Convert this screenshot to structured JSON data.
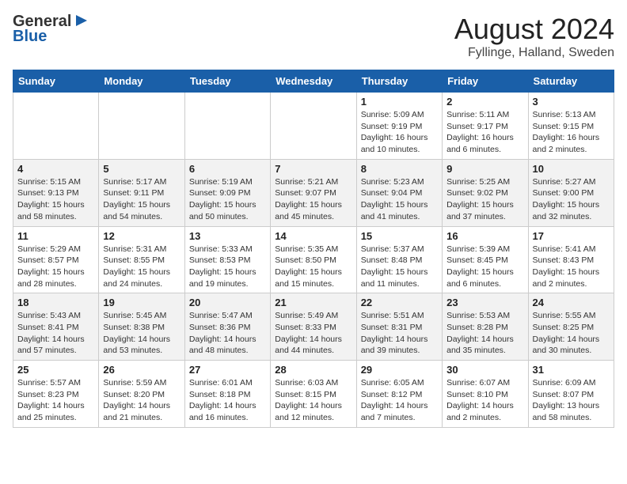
{
  "header": {
    "logo_line1": "General",
    "logo_line2": "Blue",
    "title": "August 2024",
    "subtitle": "Fyllinge, Halland, Sweden"
  },
  "weekdays": [
    "Sunday",
    "Monday",
    "Tuesday",
    "Wednesday",
    "Thursday",
    "Friday",
    "Saturday"
  ],
  "weeks": [
    [
      {
        "day": "",
        "info": ""
      },
      {
        "day": "",
        "info": ""
      },
      {
        "day": "",
        "info": ""
      },
      {
        "day": "",
        "info": ""
      },
      {
        "day": "1",
        "info": "Sunrise: 5:09 AM\nSunset: 9:19 PM\nDaylight: 16 hours\nand 10 minutes."
      },
      {
        "day": "2",
        "info": "Sunrise: 5:11 AM\nSunset: 9:17 PM\nDaylight: 16 hours\nand 6 minutes."
      },
      {
        "day": "3",
        "info": "Sunrise: 5:13 AM\nSunset: 9:15 PM\nDaylight: 16 hours\nand 2 minutes."
      }
    ],
    [
      {
        "day": "4",
        "info": "Sunrise: 5:15 AM\nSunset: 9:13 PM\nDaylight: 15 hours\nand 58 minutes."
      },
      {
        "day": "5",
        "info": "Sunrise: 5:17 AM\nSunset: 9:11 PM\nDaylight: 15 hours\nand 54 minutes."
      },
      {
        "day": "6",
        "info": "Sunrise: 5:19 AM\nSunset: 9:09 PM\nDaylight: 15 hours\nand 50 minutes."
      },
      {
        "day": "7",
        "info": "Sunrise: 5:21 AM\nSunset: 9:07 PM\nDaylight: 15 hours\nand 45 minutes."
      },
      {
        "day": "8",
        "info": "Sunrise: 5:23 AM\nSunset: 9:04 PM\nDaylight: 15 hours\nand 41 minutes."
      },
      {
        "day": "9",
        "info": "Sunrise: 5:25 AM\nSunset: 9:02 PM\nDaylight: 15 hours\nand 37 minutes."
      },
      {
        "day": "10",
        "info": "Sunrise: 5:27 AM\nSunset: 9:00 PM\nDaylight: 15 hours\nand 32 minutes."
      }
    ],
    [
      {
        "day": "11",
        "info": "Sunrise: 5:29 AM\nSunset: 8:57 PM\nDaylight: 15 hours\nand 28 minutes."
      },
      {
        "day": "12",
        "info": "Sunrise: 5:31 AM\nSunset: 8:55 PM\nDaylight: 15 hours\nand 24 minutes."
      },
      {
        "day": "13",
        "info": "Sunrise: 5:33 AM\nSunset: 8:53 PM\nDaylight: 15 hours\nand 19 minutes."
      },
      {
        "day": "14",
        "info": "Sunrise: 5:35 AM\nSunset: 8:50 PM\nDaylight: 15 hours\nand 15 minutes."
      },
      {
        "day": "15",
        "info": "Sunrise: 5:37 AM\nSunset: 8:48 PM\nDaylight: 15 hours\nand 11 minutes."
      },
      {
        "day": "16",
        "info": "Sunrise: 5:39 AM\nSunset: 8:45 PM\nDaylight: 15 hours\nand 6 minutes."
      },
      {
        "day": "17",
        "info": "Sunrise: 5:41 AM\nSunset: 8:43 PM\nDaylight: 15 hours\nand 2 minutes."
      }
    ],
    [
      {
        "day": "18",
        "info": "Sunrise: 5:43 AM\nSunset: 8:41 PM\nDaylight: 14 hours\nand 57 minutes."
      },
      {
        "day": "19",
        "info": "Sunrise: 5:45 AM\nSunset: 8:38 PM\nDaylight: 14 hours\nand 53 minutes."
      },
      {
        "day": "20",
        "info": "Sunrise: 5:47 AM\nSunset: 8:36 PM\nDaylight: 14 hours\nand 48 minutes."
      },
      {
        "day": "21",
        "info": "Sunrise: 5:49 AM\nSunset: 8:33 PM\nDaylight: 14 hours\nand 44 minutes."
      },
      {
        "day": "22",
        "info": "Sunrise: 5:51 AM\nSunset: 8:31 PM\nDaylight: 14 hours\nand 39 minutes."
      },
      {
        "day": "23",
        "info": "Sunrise: 5:53 AM\nSunset: 8:28 PM\nDaylight: 14 hours\nand 35 minutes."
      },
      {
        "day": "24",
        "info": "Sunrise: 5:55 AM\nSunset: 8:25 PM\nDaylight: 14 hours\nand 30 minutes."
      }
    ],
    [
      {
        "day": "25",
        "info": "Sunrise: 5:57 AM\nSunset: 8:23 PM\nDaylight: 14 hours\nand 25 minutes."
      },
      {
        "day": "26",
        "info": "Sunrise: 5:59 AM\nSunset: 8:20 PM\nDaylight: 14 hours\nand 21 minutes."
      },
      {
        "day": "27",
        "info": "Sunrise: 6:01 AM\nSunset: 8:18 PM\nDaylight: 14 hours\nand 16 minutes."
      },
      {
        "day": "28",
        "info": "Sunrise: 6:03 AM\nSunset: 8:15 PM\nDaylight: 14 hours\nand 12 minutes."
      },
      {
        "day": "29",
        "info": "Sunrise: 6:05 AM\nSunset: 8:12 PM\nDaylight: 14 hours\nand 7 minutes."
      },
      {
        "day": "30",
        "info": "Sunrise: 6:07 AM\nSunset: 8:10 PM\nDaylight: 14 hours\nand 2 minutes."
      },
      {
        "day": "31",
        "info": "Sunrise: 6:09 AM\nSunset: 8:07 PM\nDaylight: 13 hours\nand 58 minutes."
      }
    ]
  ]
}
